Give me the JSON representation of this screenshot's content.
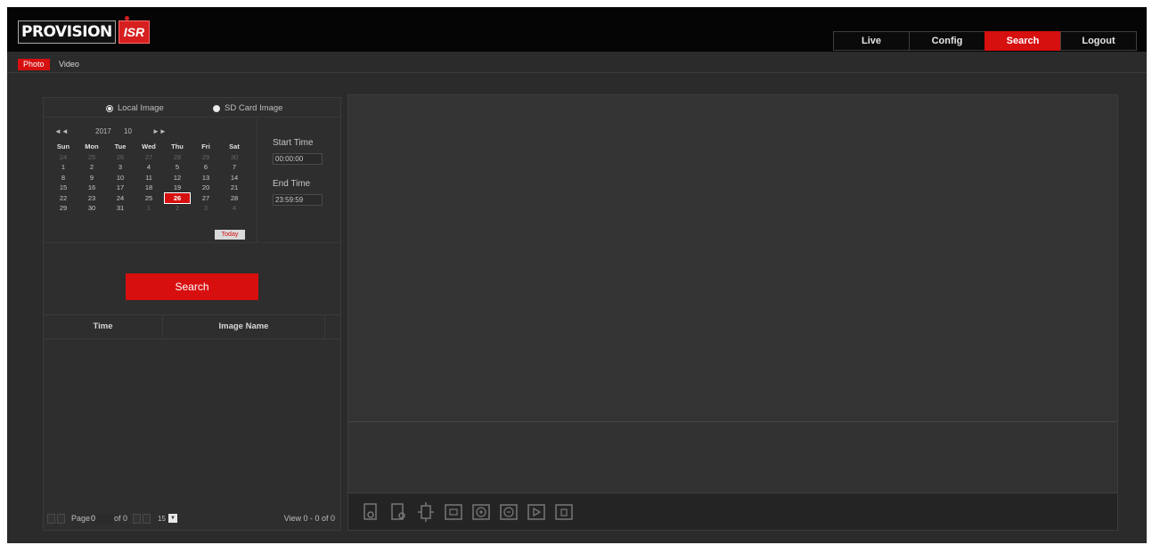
{
  "header": {
    "logo_text": "PROVISION",
    "logo_badge": "ISR",
    "nav": [
      {
        "label": "Live",
        "active": false
      },
      {
        "label": "Config",
        "active": false
      },
      {
        "label": "Search",
        "active": true
      },
      {
        "label": "Logout",
        "active": false
      }
    ]
  },
  "subtabs": {
    "photo": "Photo",
    "video": "Video"
  },
  "image_source": {
    "local": "Local Image",
    "sd": "SD Card Image",
    "selected": "local"
  },
  "calendar": {
    "prev": "◄◄",
    "next": "►►",
    "year": "2017",
    "month": "10",
    "weekdays": [
      "Sun",
      "Mon",
      "Tue",
      "Wed",
      "Thu",
      "Fri",
      "Sat"
    ],
    "weeks": [
      [
        "24",
        "25",
        "26",
        "27",
        "28",
        "29",
        "30"
      ],
      [
        "1",
        "2",
        "3",
        "4",
        "5",
        "6",
        "7"
      ],
      [
        "8",
        "9",
        "10",
        "11",
        "12",
        "13",
        "14"
      ],
      [
        "15",
        "16",
        "17",
        "18",
        "19",
        "20",
        "21"
      ],
      [
        "22",
        "23",
        "24",
        "25",
        "26",
        "27",
        "28"
      ],
      [
        "29",
        "30",
        "31",
        "1",
        "2",
        "3",
        "4"
      ]
    ],
    "selected_day": "26",
    "today": "Today"
  },
  "time": {
    "start_label": "Start Time",
    "start_value": "00:00:00",
    "end_label": "End Time",
    "end_value": "23:59:59"
  },
  "search_button": "Search",
  "results": {
    "col_time": "Time",
    "col_name": "Image Name"
  },
  "pager": {
    "page_label": "Page",
    "page_value": "0",
    "of_text": "of 0",
    "page_size": "15",
    "view_text": "View 0 - 0 of 0"
  },
  "colors": {
    "accent": "#d60f0f",
    "background": "#2b2b2b",
    "topbar": "#050505"
  },
  "toolbar_icons": [
    "snapshot-icon",
    "snapshot-save-icon",
    "fit-screen-icon",
    "fullscreen-icon",
    "zoom-in-icon",
    "zoom-out-icon",
    "play-icon",
    "stop-icon"
  ]
}
